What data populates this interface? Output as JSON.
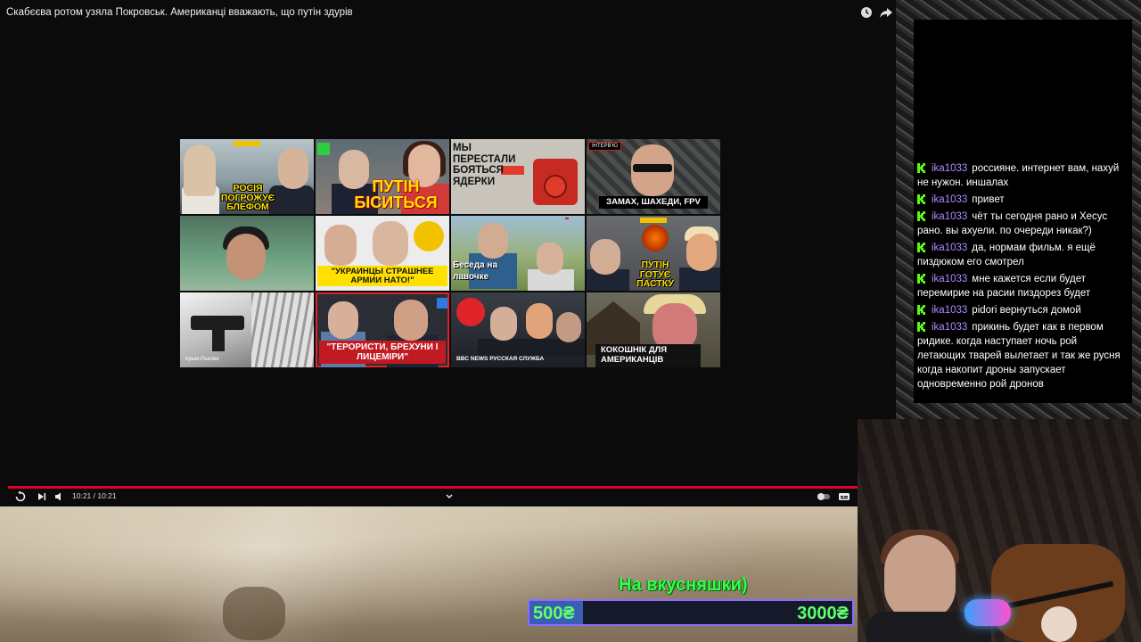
{
  "player": {
    "title": "Скабєєва ротом узяла Покровськ. Американці вважають, що путін здурів",
    "time": "10:21 / 10:21",
    "progress": 1.0,
    "accent_color": "#e1002d"
  },
  "endscreen": {
    "thumbnails": [
      {
        "caption": "РОСІЯ ПОГРОЖУЄ БЛЕФОМ"
      },
      {
        "caption": "ПУТІН БІСИТЬСЯ"
      },
      {
        "caption": "МЫ ПЕРЕСТАЛИ БОЯТЬСЯ ЯДЕРКИ"
      },
      {
        "caption": "ЗАМАХ, ШАХЕДИ, FPV",
        "tag": "ІНТЕРВ'Ю"
      },
      {
        "caption": ""
      },
      {
        "caption": "\"УКРАИНЦЫ СТРАШНЕЕ АРМИИ НАТО!\""
      },
      {
        "caption": "Беседа на лавочке"
      },
      {
        "caption": "ПУТІН ГОТУЄ ПАСТКУ"
      },
      {
        "caption": "Крым.Реалии"
      },
      {
        "caption": "\"ТЕРОРИСТИ, БРЕХУНИ І ЛИЦЕМІРИ\""
      },
      {
        "caption": "BBC NEWS РУССКАЯ СЛУЖБА"
      },
      {
        "caption": "КОКОШНІК ДЛЯ АМЕРИКАНЦІВ"
      }
    ]
  },
  "donation": {
    "label": "На вкусняшки)",
    "current": "500₴",
    "target": "3000₴",
    "progress": 0.1667,
    "text_color": "#5fff6a"
  },
  "chat": {
    "username_color": "#b08cff",
    "messages": [
      {
        "user": "ika1033",
        "text": "россияне. интернет вам, нахуй не нужон. иншалах"
      },
      {
        "user": "ika1033",
        "text": "привет"
      },
      {
        "user": "ika1033",
        "text": "чёт ты сегодня рано и Хесус рано. вы ахуели. по очереди никак?)"
      },
      {
        "user": "ika1033",
        "text": "да, нормам фильм. я ещё пиздюком его смотрел"
      },
      {
        "user": "ika1033",
        "text": "мне кажется если будет перемирие на расии пиздорез будет"
      },
      {
        "user": "ika1033",
        "text": "pidori вернуться домой"
      },
      {
        "user": "ika1033",
        "text": "прикинь будет как в первом ридике. когда наступает ночь рой летающих тварей вылетает и так же русня когда накопит дроны запускает одновременно рой дронов"
      }
    ]
  }
}
